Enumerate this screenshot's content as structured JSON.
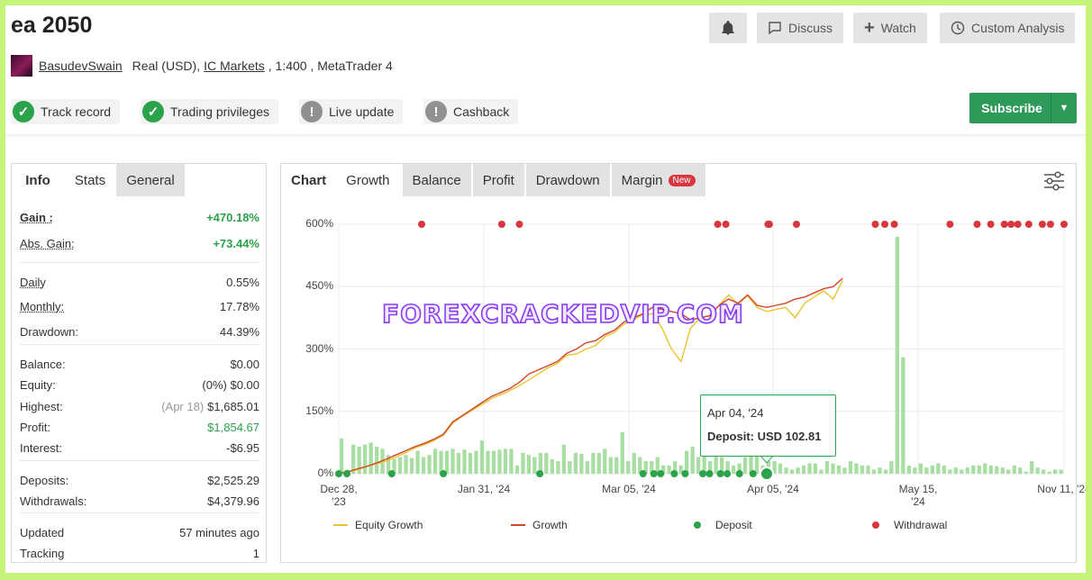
{
  "header": {
    "title": "ea 2050",
    "buttons": {
      "discuss": "Discuss",
      "watch": "Watch",
      "custom": "Custom Analysis"
    },
    "account": {
      "user": "BasudevSwain",
      "type": "Real (USD),",
      "broker": "IC Markets",
      "details": ", 1:400 , MetaTrader 4"
    },
    "badges": [
      "Track record",
      "Trading privileges",
      "Live update",
      "Cashback"
    ],
    "subscribe": "Subscribe"
  },
  "left_panel": {
    "tabs": [
      "Info",
      "Stats",
      "General"
    ],
    "rows": [
      {
        "k": "Gain :",
        "v": "+470.18%"
      },
      {
        "k": "Abs. Gain:",
        "v": "+73.44%"
      },
      {
        "k": "Daily",
        "v": "0.55%"
      },
      {
        "k": "Monthly:",
        "v": "17.78%"
      },
      {
        "k": "Drawdown:",
        "v": "44.39%"
      },
      {
        "k": "Balance:",
        "v": "$0.00"
      },
      {
        "k": "Equity:",
        "v": "(0%) $0.00"
      },
      {
        "k": "Highest:",
        "pre": "(Apr 18)",
        "v": "$1,685.01"
      },
      {
        "k": "Profit:",
        "v": "$1,854.67"
      },
      {
        "k": "Interest:",
        "v": "-$6.95"
      },
      {
        "k": "Deposits:",
        "v": "$2,525.29"
      },
      {
        "k": "Withdrawals:",
        "v": "$4,379.96"
      },
      {
        "k": "Updated",
        "v": "57 minutes ago"
      },
      {
        "k": "Tracking",
        "v": "1"
      }
    ]
  },
  "chart_panel": {
    "tabs": [
      "Chart",
      "Growth",
      "Balance",
      "Profit",
      "Drawdown",
      "Margin"
    ],
    "new_badge": "New",
    "watermark": "FOREXCRACKEDVIP.COM",
    "tooltip": {
      "date": "Apr 04, '24",
      "label": "Deposit: USD 102.81"
    }
  },
  "colors": {
    "accent": "#2e9a5a",
    "equity": "#e8c432",
    "growth": "#d2452c",
    "deposit": "#2ca24a",
    "withdrawal": "#d9363e",
    "bars": "#a9dea3"
  },
  "chart_data": {
    "type": "line",
    "x_ticks": [
      "Dec 28, '23",
      "Jan 31, '24",
      "Mar 05, '24",
      "Apr 05, '24",
      "May 15, '24",
      "Nov 11, '24"
    ],
    "y_ticks": [
      "0%",
      "150%",
      "300%",
      "450%",
      "600%"
    ],
    "ylim": [
      0,
      600
    ],
    "legend": [
      "Equity Growth",
      "Growth",
      "Deposit",
      "Withdrawal"
    ],
    "x": [
      0,
      7,
      14,
      21,
      28,
      35,
      42,
      49,
      56,
      63,
      70,
      77,
      84,
      91,
      98,
      105,
      112,
      119,
      126,
      133,
      140,
      147,
      154,
      161,
      168,
      175,
      182,
      189,
      196,
      203,
      210,
      217,
      224,
      231,
      238,
      245,
      252,
      259,
      266,
      273,
      280,
      287,
      294,
      301,
      308,
      315,
      322,
      329,
      336,
      343,
      350,
      357,
      364,
      371
    ],
    "series": [
      {
        "name": "Growth",
        "values": [
          0,
          5,
          12,
          18,
          26,
          35,
          45,
          55,
          65,
          73,
          83,
          95,
          125,
          140,
          155,
          170,
          185,
          195,
          205,
          220,
          240,
          250,
          260,
          270,
          290,
          300,
          315,
          320,
          335,
          345,
          365,
          375,
          385,
          400,
          395,
          390,
          385,
          370,
          375,
          380,
          405,
          420,
          410,
          430,
          405,
          400,
          405,
          410,
          420,
          425,
          435,
          445,
          450,
          470
        ]
      },
      {
        "name": "Equity Growth",
        "values": [
          0,
          5,
          10,
          18,
          24,
          30,
          40,
          50,
          62,
          70,
          80,
          92,
          122,
          138,
          152,
          166,
          180,
          190,
          200,
          212,
          226,
          240,
          255,
          265,
          285,
          288,
          300,
          308,
          330,
          340,
          360,
          370,
          383,
          385,
          350,
          300,
          270,
          350,
          375,
          380,
          405,
          430,
          408,
          428,
          400,
          390,
          395,
          400,
          375,
          410,
          425,
          440,
          420,
          465
        ]
      }
    ],
    "bar_values": [
      85,
      10,
      70,
      65,
      70,
      75,
      65,
      60,
      45,
      35,
      40,
      45,
      38,
      55,
      40,
      45,
      60,
      55,
      55,
      60,
      50,
      58,
      50,
      55,
      80,
      55,
      55,
      58,
      60,
      60,
      20,
      50,
      45,
      40,
      50,
      50,
      35,
      30,
      70,
      30,
      50,
      48,
      30,
      50,
      50,
      60,
      40,
      40,
      100,
      30,
      50,
      40,
      30,
      30,
      40,
      20,
      20,
      30,
      20,
      55,
      65,
      40,
      45,
      30,
      48,
      40,
      30,
      20,
      25,
      40,
      48,
      60,
      20,
      30,
      30,
      25,
      15,
      10,
      15,
      20,
      25,
      25,
      10,
      30,
      25,
      20,
      15,
      30,
      25,
      20,
      20,
      10,
      15,
      10,
      30,
      570,
      280,
      20,
      15,
      25,
      15,
      20,
      25,
      20,
      10,
      15,
      10,
      15,
      20,
      20,
      25,
      20,
      18,
      15,
      10,
      20,
      15,
      5,
      30,
      15,
      10,
      5,
      10,
      10
    ],
    "deposit_x": [
      0,
      6,
      39,
      77,
      148,
      224,
      232,
      237,
      247,
      255,
      268,
      273,
      281,
      286,
      295,
      305
    ],
    "withdrawal_x": [
      61,
      120,
      133,
      279,
      285,
      316,
      317,
      337,
      395,
      402,
      409,
      450,
      470,
      480,
      490,
      495,
      500,
      508,
      518,
      524,
      534
    ],
    "tooltip_point": {
      "date": "Apr 04, '24",
      "deposit": 102.81
    }
  }
}
